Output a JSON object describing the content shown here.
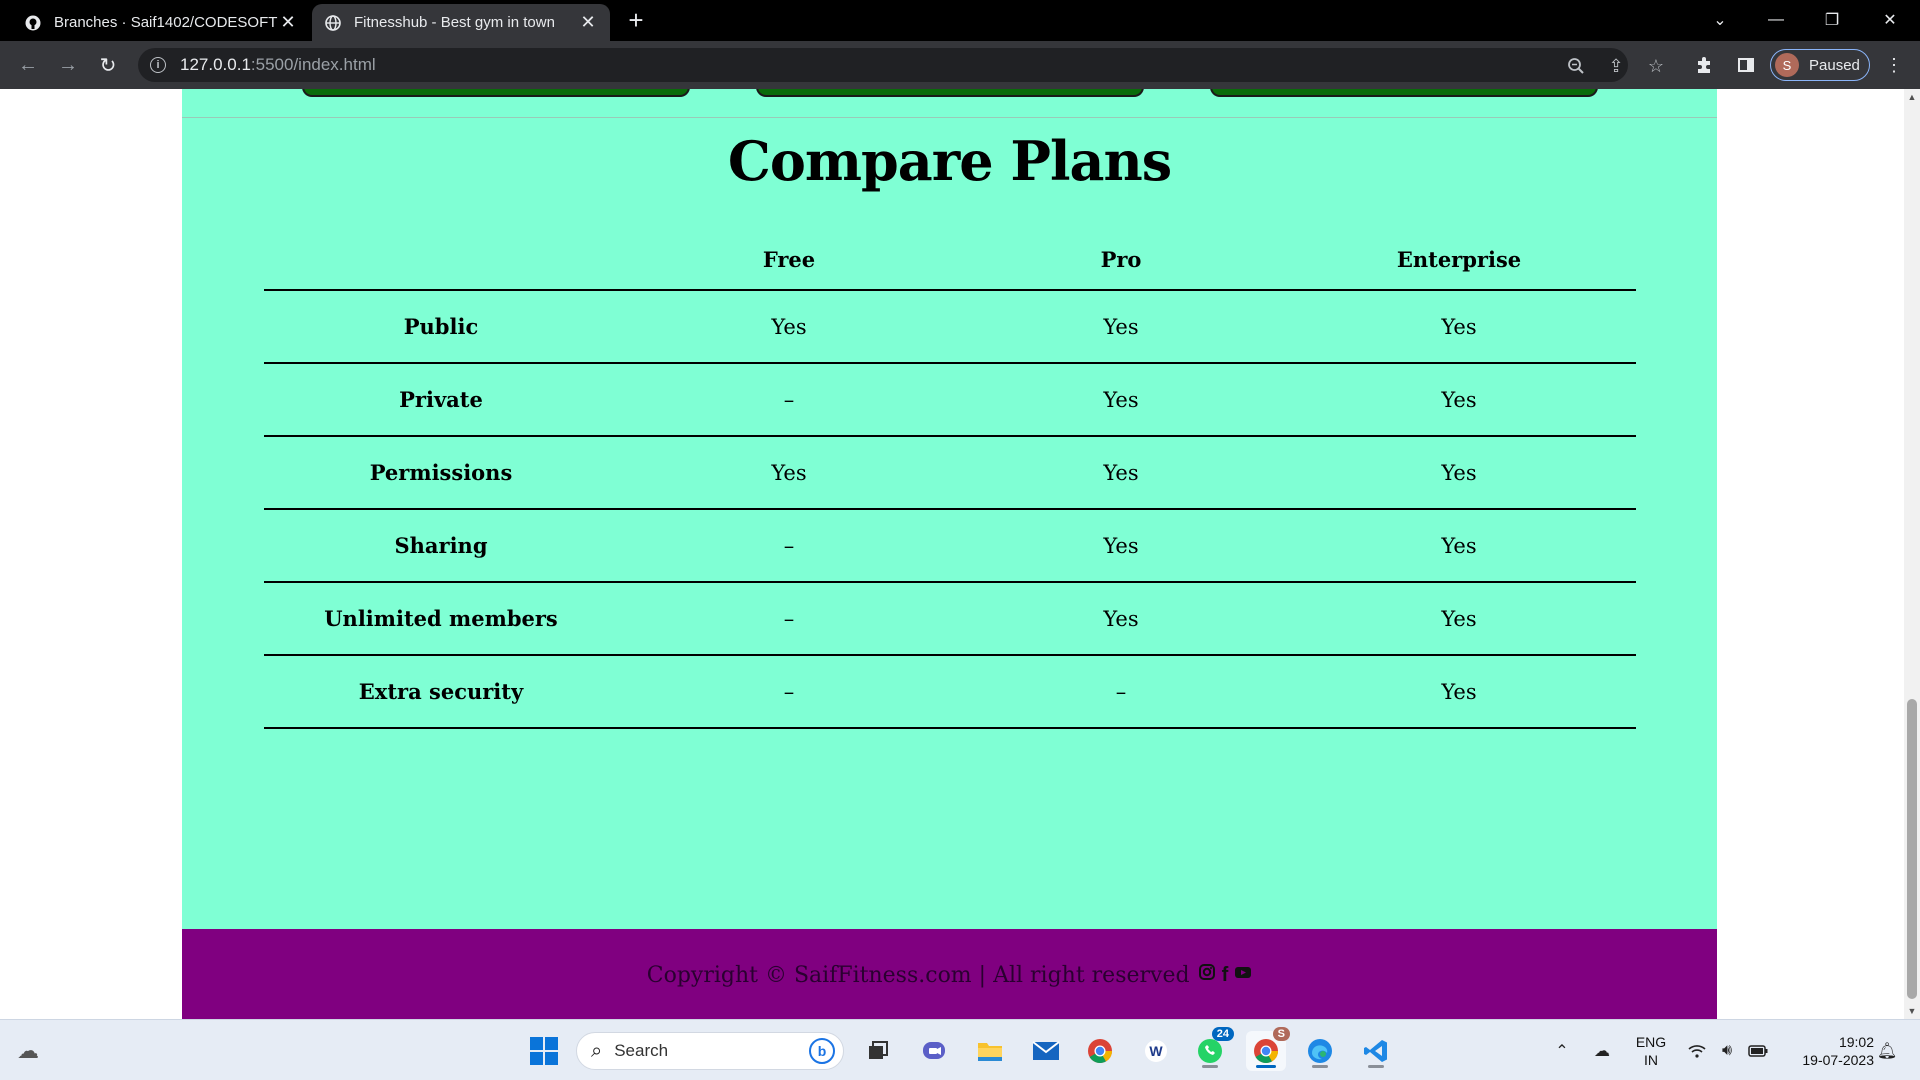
{
  "browser": {
    "tabs": [
      {
        "title": "Branches · Saif1402/CODESOFT",
        "icon": "github-icon",
        "active": false
      },
      {
        "title": "Fitnesshub - Best gym in town",
        "icon": "globe-icon",
        "active": true
      }
    ],
    "url_host": "127.0.0.1",
    "url_path": ":5500/index.html",
    "profile": {
      "initial": "S",
      "status": "Paused"
    }
  },
  "page": {
    "compare_title": "Compare Plans",
    "table": {
      "headers": [
        "",
        "Free",
        "Pro",
        "Enterprise"
      ],
      "rows": [
        {
          "feature": "Public",
          "free": "Yes",
          "pro": "Yes",
          "enterprise": "Yes"
        },
        {
          "feature": "Private",
          "free": "–",
          "pro": "Yes",
          "enterprise": "Yes"
        },
        {
          "feature": "Permissions",
          "free": "Yes",
          "pro": "Yes",
          "enterprise": "Yes"
        },
        {
          "feature": "Sharing",
          "free": "–",
          "pro": "Yes",
          "enterprise": "Yes"
        },
        {
          "feature": "Unlimited members",
          "free": "–",
          "pro": "Yes",
          "enterprise": "Yes"
        },
        {
          "feature": "Extra security",
          "free": "–",
          "pro": "–",
          "enterprise": "Yes"
        }
      ]
    },
    "footer_text": "Copyright © SaifFitness.com | All right reserved",
    "colors": {
      "section_bg": "#7fffd4",
      "footer_bg": "#800080",
      "card_button": "#0a6b0a"
    }
  },
  "taskbar": {
    "search_placeholder": "Search",
    "whatsapp_badge": "24",
    "chrome_profile_badge": "S",
    "lang_line1": "ENG",
    "lang_line2": "IN",
    "time": "19:02",
    "date": "19-07-2023"
  }
}
